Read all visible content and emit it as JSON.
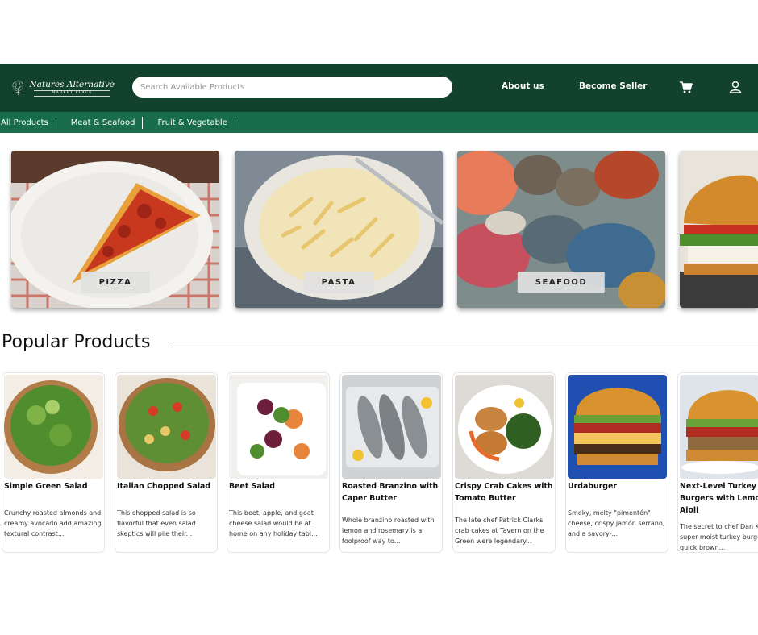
{
  "header": {
    "logo_name": "Natures Alternative",
    "logo_sub": "MARKET PLACE",
    "search_placeholder": "Search Available Products",
    "about": "About us",
    "seller": "Become Seller",
    "icons": [
      "cart-icon",
      "user-icon"
    ],
    "bg_color": "#12412e"
  },
  "categories": {
    "bg_color": "#186d4c",
    "items": [
      "All Products",
      "Meat & Seafood",
      "Fruit & Vegetable"
    ]
  },
  "banners": [
    {
      "label": "PIZZA"
    },
    {
      "label": "PASTA"
    },
    {
      "label": "SEAFOOD"
    },
    {
      "label": ""
    }
  ],
  "popular": {
    "title": "Popular Products",
    "products": [
      {
        "title": "Simple Green Salad",
        "desc": "Crunchy roasted almonds and creamy avocado add amazing textural contrast..."
      },
      {
        "title": "Italian Chopped Salad",
        "desc": "This chopped salad is so flavorful that even salad skeptics will pile their..."
      },
      {
        "title": "Beet Salad",
        "desc": "This beet, apple, and goat cheese salad would be at home on any holiday tabl..."
      },
      {
        "title": "Roasted Branzino with Caper Butter",
        "desc": "Whole branzino roasted with lemon and rosemary is a foolproof way to..."
      },
      {
        "title": "Crispy Crab Cakes with Tomato Butter",
        "desc": "The late chef Patrick Clarks crab cakes at Tavern on the Green were legendary..."
      },
      {
        "title": "Urdaburger",
        "desc": "Smoky, melty \"pimentón\" cheese, crispy jamón serrano, and a savory-..."
      },
      {
        "title": "Next-Level Turkey Burgers with Lemon Aioli",
        "desc": "The secret to chef Dan Klugers super-moist turkey burgers? A quick brown..."
      }
    ]
  }
}
